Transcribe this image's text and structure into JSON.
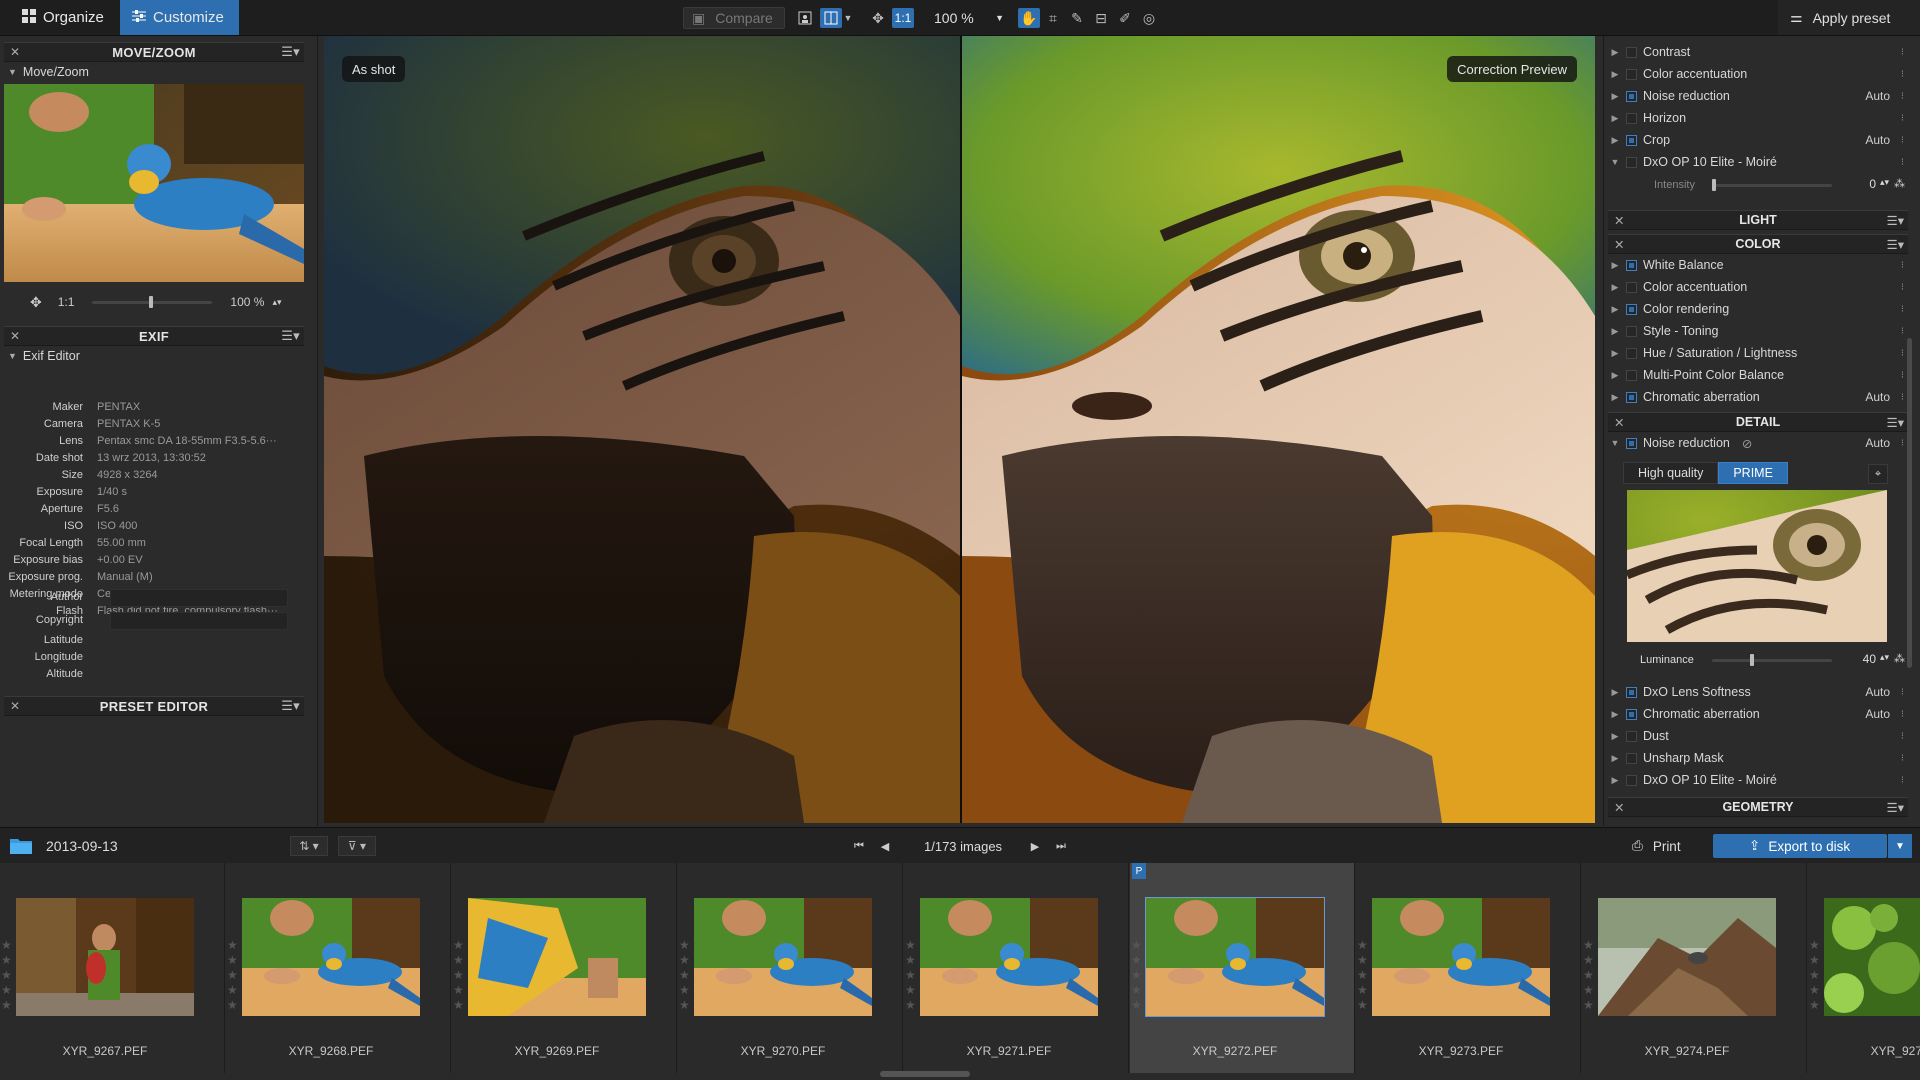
{
  "toolbar": {
    "organize": "Organize",
    "customize": "Customize",
    "compare": "Compare",
    "one_to_one": "1:1",
    "zoom_value": "100 %",
    "apply_preset": "Apply preset"
  },
  "move_zoom": {
    "title": "MOVE/ZOOM",
    "sub": "Move/Zoom",
    "ratio": "1:1",
    "percent": "100 %"
  },
  "exif": {
    "title": "EXIF",
    "sub": "Exif Editor",
    "rows": [
      {
        "k": "Maker",
        "v": "PENTAX"
      },
      {
        "k": "Camera",
        "v": "PENTAX K-5"
      },
      {
        "k": "Lens",
        "v": "Pentax smc DA 18-55mm F3.5-5.6···"
      },
      {
        "k": "Date shot",
        "v": "13 wrz 2013, 13:30:52"
      },
      {
        "k": "Size",
        "v": "4928 x 3264"
      },
      {
        "k": "Exposure",
        "v": "1/40 s"
      },
      {
        "k": "Aperture",
        "v": "F5.6"
      },
      {
        "k": "ISO",
        "v": "ISO 400"
      },
      {
        "k": "Focal Length",
        "v": "55.00 mm"
      },
      {
        "k": "Exposure bias",
        "v": "+0.00 EV"
      },
      {
        "k": "Exposure prog.",
        "v": "Manual (M)"
      },
      {
        "k": "Metering mode",
        "v": "Center weighted average"
      },
      {
        "k": "Flash",
        "v": "Flash did not fire, compulsory flash···"
      }
    ],
    "author": "Author",
    "copyright": "Copyright",
    "latitude": "Latitude",
    "longitude": "Longitude",
    "altitude": "Altitude"
  },
  "preset_editor": {
    "title": "PRESET EDITOR"
  },
  "viewer": {
    "left_label": "As shot",
    "right_label": "Correction Preview"
  },
  "right": {
    "top_rows": [
      {
        "label": "Contrast",
        "auto": "",
        "on": false
      },
      {
        "label": "Color accentuation",
        "auto": "",
        "on": false
      },
      {
        "label": "Noise reduction",
        "auto": "Auto",
        "on": true
      },
      {
        "label": "Horizon",
        "auto": "",
        "on": false
      },
      {
        "label": "Crop",
        "auto": "Auto",
        "on": true
      },
      {
        "label": "DxO OP 10 Elite - Moiré",
        "auto": "",
        "on": false
      }
    ],
    "intensity_label": "Intensity",
    "intensity_value": "0",
    "light": "LIGHT",
    "color": "COLOR",
    "color_rows": [
      {
        "label": "White Balance",
        "auto": "",
        "on": true
      },
      {
        "label": "Color accentuation",
        "auto": "",
        "on": false
      },
      {
        "label": "Color rendering",
        "auto": "",
        "on": true
      },
      {
        "label": "Style - Toning",
        "auto": "",
        "on": false
      },
      {
        "label": "Hue / Saturation / Lightness",
        "auto": "",
        "on": false
      },
      {
        "label": "Multi-Point Color Balance",
        "auto": "",
        "on": false
      },
      {
        "label": "Chromatic aberration",
        "auto": "Auto",
        "on": true
      }
    ],
    "detail": "DETAIL",
    "noise_reduction": "Noise reduction",
    "noise_auto": "Auto",
    "high_quality": "High quality",
    "prime": "PRIME",
    "luminance_label": "Luminance",
    "luminance_value": "40",
    "detail_rows": [
      {
        "label": "DxO Lens Softness",
        "auto": "Auto",
        "on": true
      },
      {
        "label": "Chromatic aberration",
        "auto": "Auto",
        "on": true
      },
      {
        "label": "Dust",
        "auto": "",
        "on": false
      },
      {
        "label": "Unsharp Mask",
        "auto": "",
        "on": false
      },
      {
        "label": "DxO OP 10 Elite - Moiré",
        "auto": "",
        "on": false
      }
    ],
    "geometry": "GEOMETRY"
  },
  "filmbar": {
    "folder": "2013-09-13",
    "count": "1/173 images",
    "print": "Print",
    "export": "Export to disk"
  },
  "filmstrip": [
    {
      "name": "XYR_9267.PEF",
      "scene": "keeper"
    },
    {
      "name": "XYR_9268.PEF",
      "scene": "macaw"
    },
    {
      "name": "XYR_9269.PEF",
      "scene": "wing"
    },
    {
      "name": "XYR_9270.PEF",
      "scene": "macaw"
    },
    {
      "name": "XYR_9271.PEF",
      "scene": "macaw"
    },
    {
      "name": "XYR_9272.PEF",
      "scene": "macaw",
      "selected": true,
      "badge": "P"
    },
    {
      "name": "XYR_9273.PEF",
      "scene": "macaw"
    },
    {
      "name": "XYR_9274.PEF",
      "scene": "tree"
    },
    {
      "name": "XYR_9275.PEF",
      "scene": "leaves"
    }
  ]
}
